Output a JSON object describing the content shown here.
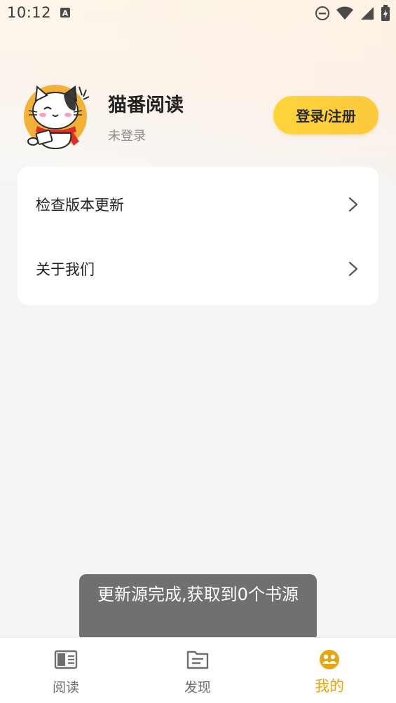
{
  "status_bar": {
    "time": "10:12",
    "left_icons": [
      "keyboard-a-icon"
    ],
    "right_icons": [
      "dnd-icon",
      "wifi-icon",
      "signal-icon",
      "battery-charging-icon"
    ]
  },
  "profile": {
    "app_name": "猫番阅读",
    "login_status": "未登录",
    "login_button": "登录/注册",
    "avatar_icon": "cat-mascot-icon"
  },
  "menu": {
    "items": [
      {
        "label": "检查版本更新",
        "icon": "chevron-right-icon"
      },
      {
        "label": "关于我们",
        "icon": "chevron-right-icon"
      }
    ]
  },
  "toast": {
    "message": "更新源完成,获取到0个书源"
  },
  "bottom_nav": {
    "items": [
      {
        "label": "阅读",
        "icon": "book-icon",
        "active": false
      },
      {
        "label": "发现",
        "icon": "discover-icon",
        "active": false
      },
      {
        "label": "我的",
        "icon": "profile-icon",
        "active": true
      }
    ]
  },
  "colors": {
    "accent": "#e6a515",
    "button_yellow": "#ffd43a",
    "toast_bg": "#707070",
    "page_bg": "#f4f4f4"
  }
}
